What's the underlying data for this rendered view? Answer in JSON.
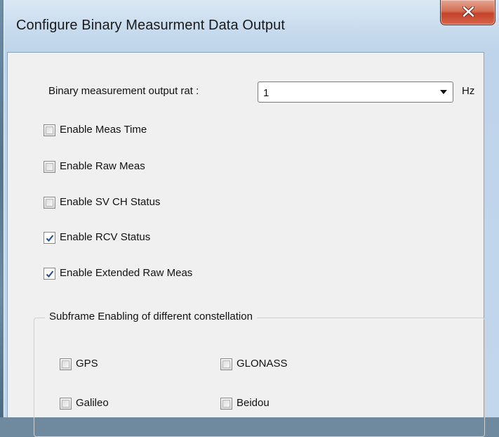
{
  "window": {
    "title": "Configure Binary Measurment Data Output",
    "close_icon": "close-x-icon"
  },
  "rate": {
    "label": "Binary measurement output rat :",
    "value": "1",
    "unit": "Hz"
  },
  "options": [
    {
      "label": "Enable Meas Time",
      "checked": false
    },
    {
      "label": "Enable Raw Meas",
      "checked": false
    },
    {
      "label": "Enable SV CH Status",
      "checked": false
    },
    {
      "label": "Enable RCV Status",
      "checked": true
    },
    {
      "label": "Enable Extended  Raw Meas",
      "checked": true
    }
  ],
  "subframe": {
    "title": "Subframe Enabling of different constellation",
    "items": [
      {
        "label": "GPS",
        "checked": false
      },
      {
        "label": "GLONASS",
        "checked": false
      },
      {
        "label": "Galileo",
        "checked": false
      },
      {
        "label": "Beidou",
        "checked": false
      }
    ]
  },
  "colors": {
    "close_button": "#c3432a",
    "checkmark": "#2b4f9a"
  }
}
